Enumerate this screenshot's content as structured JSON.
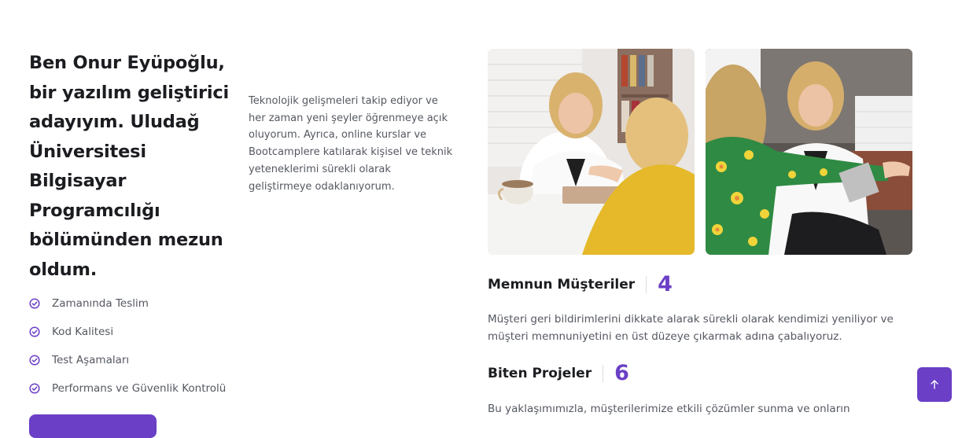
{
  "about": {
    "headline": "Ben Onur Eyüpoğlu, bir yazılım geliştirici adayıyım. Uludağ Üniversitesi Bilgisayar Programcılığı bölümünden mezun oldum.",
    "intro": "Teknolojik gelişmeleri takip ediyor ve her zaman yeni şeyler öğrenmeye açık oluyorum. Ayrıca, online kurslar ve Bootcamplere katılarak kişisel ve teknik yeteneklerimi sürekli olarak geliştirmeye odaklanıyorum."
  },
  "features": [
    {
      "label": "Zamanında Teslim",
      "icon": "check-circle-icon"
    },
    {
      "label": "Kod Kalitesi",
      "icon": "check-circle-icon"
    },
    {
      "label": "Test Aşamaları",
      "icon": "check-circle-icon"
    },
    {
      "label": "Performans ve Güvenlik Kontrolü",
      "icon": "check-circle-icon"
    }
  ],
  "stats": [
    {
      "title": "Memnun Müşteriler",
      "value": "4",
      "description": "Müşteri geri bildirimlerini dikkate alarak sürekli olarak kendimizi yeniliyor ve müşteri memnuniyetini en üst düzeye çıkarmak adına çabalıyoruz."
    },
    {
      "title": "Biten Projeler",
      "value": "6",
      "description": "Bu yaklaşımımızla, müşterilerimize etkili çözümler sunma ve onların"
    }
  ],
  "scroll_top": {
    "icon": "arrow-up-icon"
  },
  "colors": {
    "accent": "#6b3fc6",
    "heading": "#1c1d21",
    "body_text": "#545860"
  }
}
